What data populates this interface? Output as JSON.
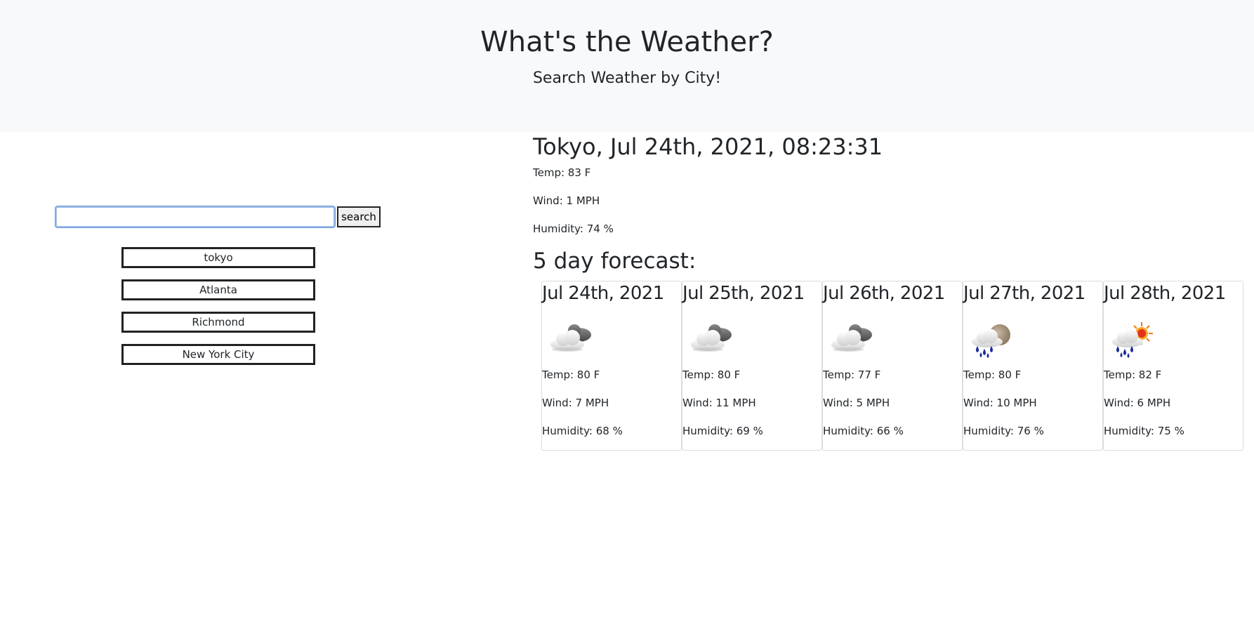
{
  "header": {
    "title": "What's the Weather?",
    "subtitle": "Search Weather by City!"
  },
  "search": {
    "value": "",
    "placeholder": "",
    "button_label": "search"
  },
  "history": [
    "tokyo",
    "Atlanta",
    "Richmond",
    "New York City"
  ],
  "current": {
    "title": "Tokyo, Jul 24th, 2021, 08:23:31",
    "temp": "Temp: 83 F",
    "wind": "Wind: 1 MPH",
    "humidity": "Humidity: 74 %"
  },
  "forecast": {
    "title": "5 day forecast:",
    "days": [
      {
        "date": "Jul 24th, 2021",
        "icon": "overcast-clouds-icon",
        "temp": "Temp: 80 F",
        "wind": "Wind: 7 MPH",
        "humidity": "Humidity: 68 %"
      },
      {
        "date": "Jul 25th, 2021",
        "icon": "overcast-clouds-icon",
        "temp": "Temp: 80 F",
        "wind": "Wind: 11 MPH",
        "humidity": "Humidity: 69 %"
      },
      {
        "date": "Jul 26th, 2021",
        "icon": "overcast-clouds-icon",
        "temp": "Temp: 77 F",
        "wind": "Wind: 5 MPH",
        "humidity": "Humidity: 66 %"
      },
      {
        "date": "Jul 27th, 2021",
        "icon": "rain-night-icon",
        "temp": "Temp: 80 F",
        "wind": "Wind: 10 MPH",
        "humidity": "Humidity: 76 %"
      },
      {
        "date": "Jul 28th, 2021",
        "icon": "rain-sun-icon",
        "temp": "Temp: 82 F",
        "wind": "Wind: 6 MPH",
        "humidity": "Humidity: 75 %"
      }
    ]
  }
}
